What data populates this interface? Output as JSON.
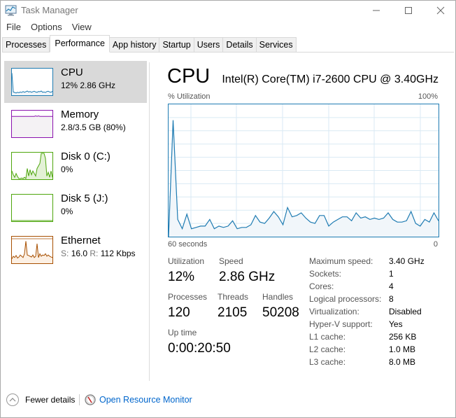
{
  "window": {
    "title": "Task Manager",
    "controls": {
      "minimize": "—",
      "maximize": "☐",
      "close": "✕"
    }
  },
  "menu": [
    "File",
    "Options",
    "View"
  ],
  "tabs": [
    {
      "label": "Processes",
      "active": false
    },
    {
      "label": "Performance",
      "active": true
    },
    {
      "label": "App history",
      "active": false
    },
    {
      "label": "Startup",
      "active": false
    },
    {
      "label": "Users",
      "active": false
    },
    {
      "label": "Details",
      "active": false
    },
    {
      "label": "Services",
      "active": false
    }
  ],
  "sidebar": {
    "items": [
      {
        "title": "CPU",
        "subtitle": "12% 2.86 GHz",
        "color": "#1e7bb2",
        "fill": "#f1f6fa",
        "selected": true
      },
      {
        "title": "Memory",
        "subtitle": "2.8/3.5 GB (80%)",
        "color": "#8b12ae",
        "fill": "#f4f2f4",
        "selected": false
      },
      {
        "title": "Disk 0 (C:)",
        "subtitle": "0%",
        "color": "#4da60c",
        "fill": "#eff7e8",
        "selected": false
      },
      {
        "title": "Disk 5 (J:)",
        "subtitle": "0%",
        "color": "#4da60c",
        "fill": "#ffffff",
        "selected": false
      },
      {
        "title": "Ethernet",
        "subtitle_s_label": "S:",
        "subtitle_s_value": "16.0",
        "subtitle_r_label": "R:",
        "subtitle_r_value": "112 Kbps",
        "color": "#a74f01",
        "fill": "#fcf3eb",
        "selected": false
      }
    ]
  },
  "main": {
    "title": "CPU",
    "model": "Intel(R) Core(TM) i7-2600 CPU @ 3.40GHz",
    "graph_label": "% Utilization",
    "graph_max_label": "100%",
    "axis_left": "60 seconds",
    "axis_right": "0",
    "stats": {
      "utilization_label": "Utilization",
      "utilization": "12%",
      "speed_label": "Speed",
      "speed": "2.86 GHz",
      "processes_label": "Processes",
      "processes": "120",
      "threads_label": "Threads",
      "threads": "2105",
      "handles_label": "Handles",
      "handles": "50208",
      "uptime_label": "Up time",
      "uptime": "0:00:20:50"
    },
    "specs": [
      {
        "label": "Maximum speed:",
        "value": "3.40 GHz"
      },
      {
        "label": "Sockets:",
        "value": "1"
      },
      {
        "label": "Cores:",
        "value": "4"
      },
      {
        "label": "Logical processors:",
        "value": "8"
      },
      {
        "label": "Virtualization:",
        "value": "Disabled"
      },
      {
        "label": "Hyper-V support:",
        "value": "Yes"
      },
      {
        "label": "L1 cache:",
        "value": "256 KB"
      },
      {
        "label": "L2 cache:",
        "value": "1.0 MB"
      },
      {
        "label": "L3 cache:",
        "value": "8.0 MB"
      }
    ]
  },
  "footer": {
    "fewer_details": "Fewer details",
    "resource_monitor": "Open Resource Monitor"
  },
  "colors": {
    "cpu_line": "#1e7bb2",
    "cpu_fill": "#f1f6fa",
    "grid": "#d9eaf4",
    "link": "#0066cc",
    "selected_bg": "#d9d9d9"
  },
  "chart_data": {
    "type": "area",
    "title": "% Utilization",
    "xlabel": "60 seconds",
    "x_range_seconds": [
      60,
      0
    ],
    "ylim": [
      0,
      100
    ],
    "grid": true,
    "values": [
      0,
      88,
      13,
      6,
      17,
      6,
      7,
      8,
      8,
      13,
      6,
      8,
      7,
      8,
      12,
      6,
      7,
      7,
      9,
      16,
      11,
      10,
      14,
      19,
      15,
      9,
      22,
      15,
      16,
      18,
      14,
      11,
      10,
      16,
      16,
      8,
      11,
      13,
      15,
      15,
      12,
      18,
      14,
      15,
      13,
      14,
      13,
      14,
      18,
      13,
      11,
      11,
      12,
      19,
      10,
      8,
      13,
      11,
      18,
      12
    ]
  },
  "thumbnails": {
    "cpu": [
      85,
      10,
      8,
      6,
      9,
      7,
      10,
      8,
      12,
      9,
      11,
      14,
      10,
      12,
      9,
      11,
      13,
      10,
      9,
      12,
      11,
      14,
      9,
      10,
      8,
      12,
      13,
      10,
      9,
      13
    ],
    "memory": [
      80,
      80,
      80,
      80,
      80,
      80,
      80,
      80,
      80,
      80,
      80,
      80,
      80,
      80,
      80,
      80,
      80,
      82,
      80,
      82,
      80,
      80,
      80,
      80,
      80,
      80,
      80,
      80,
      80,
      80
    ],
    "disk0": [
      30,
      15,
      5,
      20,
      8,
      0,
      0,
      2,
      0,
      5,
      0,
      40,
      10,
      35,
      15,
      30,
      20,
      10,
      40,
      50,
      60,
      100,
      100,
      100,
      80,
      10,
      25,
      5,
      30,
      5
    ],
    "disk5": [
      0,
      0,
      0,
      0,
      0,
      0,
      0,
      0,
      0,
      0,
      0,
      0,
      0,
      0,
      0,
      0,
      0,
      0,
      0,
      0,
      0,
      0,
      0,
      0,
      0,
      0,
      0,
      0,
      0,
      0
    ],
    "ethernet": [
      15,
      25,
      20,
      28,
      18,
      22,
      30,
      25,
      20,
      35,
      85,
      30,
      28,
      25,
      22,
      30,
      20,
      25,
      75,
      20,
      35,
      25,
      30,
      28,
      35,
      25,
      30,
      25,
      22,
      20
    ]
  }
}
